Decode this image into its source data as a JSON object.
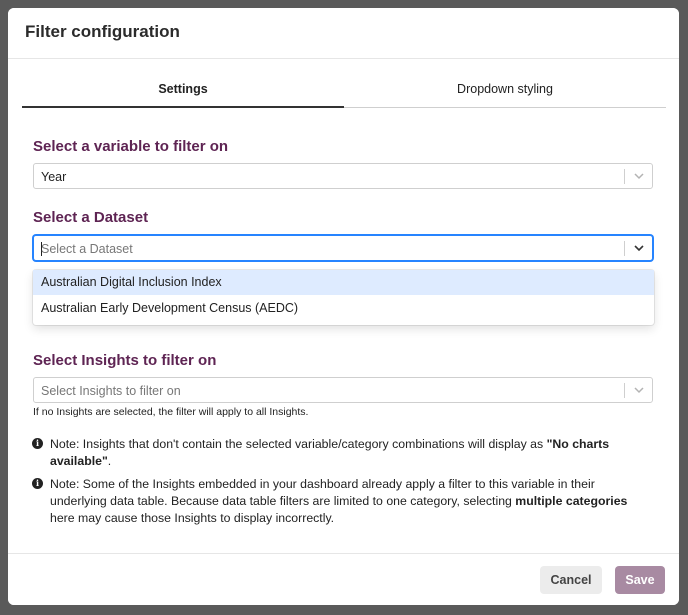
{
  "modal": {
    "title": "Filter configuration"
  },
  "tabs": [
    {
      "label": "Settings",
      "active": true
    },
    {
      "label": "Dropdown styling",
      "active": false
    }
  ],
  "variable_section": {
    "label": "Select a variable to filter on",
    "value": "Year"
  },
  "dataset_section": {
    "label": "Select a Dataset",
    "placeholder": "Select a Dataset",
    "options": [
      "Australian Digital Inclusion Index",
      "Australian Early Development Census (AEDC)"
    ]
  },
  "insights_section": {
    "label": "Select Insights to filter on",
    "placeholder": "Select Insights to filter on",
    "hint": "If no Insights are selected, the filter will apply to all Insights."
  },
  "notes": {
    "note1_prefix": "Note: Insights that don't contain the selected variable/category combinations will display as ",
    "note1_bold": "\"No charts available\"",
    "note1_suffix": ".",
    "note2_prefix": "Note: Some of the Insights embedded in your dashboard already apply a filter to this variable in their underlying data table. Because data table filters are limited to one category, selecting ",
    "note2_bold": "multiple categories",
    "note2_suffix": " here may cause those Insights to display incorrectly."
  },
  "footer": {
    "cancel_label": "Cancel",
    "save_label": "Save"
  },
  "colors": {
    "accent": "#5e2453",
    "save_button": "#a88aa2",
    "focus": "#2684ff",
    "option_highlight": "#deebff"
  }
}
